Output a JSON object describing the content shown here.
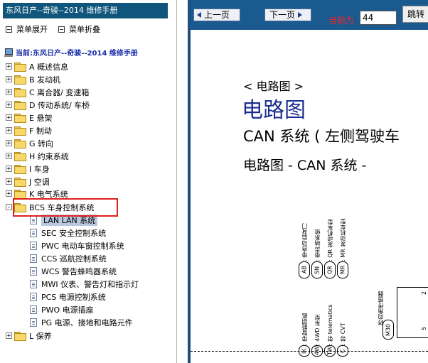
{
  "left": {
    "title": "东风日产--奇骏--2014 维修手册",
    "expand_all": "菜单展开",
    "collapse_all": "菜单折叠",
    "current": "当前:东风日产--奇骏--2014 维修手册",
    "tree": [
      {
        "label": "A 概述信息",
        "expander": "+"
      },
      {
        "label": "B 发动机",
        "expander": "+"
      },
      {
        "label": "C 离合器/ 变速箱",
        "expander": "+"
      },
      {
        "label": "D 传动系统/ 车桥",
        "expander": "+"
      },
      {
        "label": "E 悬架",
        "expander": "+"
      },
      {
        "label": "F 制动",
        "expander": "+"
      },
      {
        "label": "G 转向",
        "expander": "+"
      },
      {
        "label": "H 约束系统",
        "expander": "+"
      },
      {
        "label": "I 车身",
        "expander": "+"
      },
      {
        "label": "J 空调",
        "expander": "+"
      },
      {
        "label": "K 电气系统",
        "expander": "+"
      },
      {
        "label": "BCS 车身控制系统",
        "expander": "-"
      }
    ],
    "children": [
      "LAN LAN 系统",
      "SEC 安全控制系统",
      "PWC 电动车窗控制系统",
      "CCS 巡航控制系统",
      "WCS 警告蜂鸣器系统",
      "MWI 仪表、警告灯和指示灯",
      "PCS 电源控制系统",
      "PWO 电源插座",
      "PG 电源、接地和电路元件"
    ],
    "last": {
      "label": "L 保养",
      "expander": "+"
    }
  },
  "toolbar": {
    "prev": "上一页",
    "next": "下一页",
    "current_label": "当前为",
    "page_value": "44",
    "jump": "跳转"
  },
  "doc": {
    "heading_small": "< 电路图 >",
    "heading_big": "电路图",
    "subtitle": "CAN 系统 ( 左侧驾驶车",
    "subtitle2": "电路图 - CAN 系统 -",
    "labels_top": [
      {
        "code": "AB",
        "text": ": 带自动后背门"
      },
      {
        "code": "SN",
        "text": ": 带声纳系统"
      },
      {
        "code": "QR",
        "text": ": QR 发动机车型"
      },
      {
        "code": "MR",
        "text": ": MR 发动机车型"
      }
    ],
    "labels_bottom": [
      {
        "code": "IK",
        "text": ": 带智能钥匙"
      },
      {
        "code": "4W",
        "text": ": 4WD 车型"
      },
      {
        "code": "TW",
        "text": ": 带 telematics"
      },
      {
        "code": "C",
        "text": ": 带 CVT"
      }
    ],
    "sensor_label": "转向角传感器",
    "sensor_code": "M30",
    "pin_top": "2",
    "pin_bottom": "5"
  }
}
